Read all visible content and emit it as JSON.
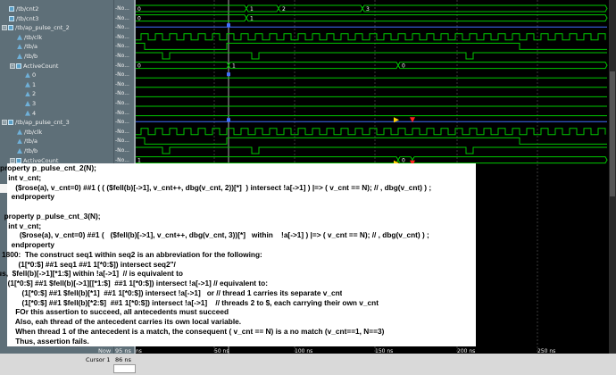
{
  "signals": [
    {
      "label": "/tb/cnt2",
      "type": "bus",
      "indent": 0,
      "toggle": "none",
      "value": "-No..."
    },
    {
      "label": "/tb/cnt3",
      "type": "bus",
      "indent": 0,
      "toggle": "none",
      "value": "-No..."
    },
    {
      "label": "/tb/ap_pulse_cnt_2",
      "type": "bus",
      "indent": 0,
      "toggle": "-",
      "value": "-No..."
    },
    {
      "label": "/tb/clk",
      "type": "bit",
      "indent": 1,
      "toggle": "none",
      "value": "-No..."
    },
    {
      "label": "/tb/a",
      "type": "bit",
      "indent": 1,
      "toggle": "none",
      "value": "-No..."
    },
    {
      "label": "/tb/b",
      "type": "bit",
      "indent": 1,
      "toggle": "none",
      "value": "-No..."
    },
    {
      "label": "ActiveCount",
      "type": "bus",
      "indent": 1,
      "toggle": "-",
      "value": "-No..."
    },
    {
      "label": "0",
      "type": "bit",
      "indent": 2,
      "toggle": "none",
      "value": "-No..."
    },
    {
      "label": "1",
      "type": "bit",
      "indent": 2,
      "toggle": "none",
      "value": "-No..."
    },
    {
      "label": "2",
      "type": "bit",
      "indent": 2,
      "toggle": "none",
      "value": "-No..."
    },
    {
      "label": "3",
      "type": "bit",
      "indent": 2,
      "toggle": "none",
      "value": "-No..."
    },
    {
      "label": "4",
      "type": "bit",
      "indent": 2,
      "toggle": "none",
      "value": "-No..."
    },
    {
      "label": "/tb/ap_pulse_cnt_3",
      "type": "bus",
      "indent": 0,
      "toggle": "-",
      "value": "-No..."
    },
    {
      "label": "/tb/clk",
      "type": "bit",
      "indent": 1,
      "toggle": "none",
      "value": "-No..."
    },
    {
      "label": "/tb/a",
      "type": "bit",
      "indent": 1,
      "toggle": "none",
      "value": "-No..."
    },
    {
      "label": "/tb/b",
      "type": "bit",
      "indent": 1,
      "toggle": "none",
      "value": "-No..."
    },
    {
      "label": "ActiveCount",
      "type": "bus",
      "indent": 1,
      "toggle": "-",
      "value": "-No..."
    },
    {
      "label": "0",
      "type": "bit",
      "indent": 2,
      "toggle": "none",
      "value": "-No..."
    },
    {
      "label": "1",
      "type": "bit",
      "indent": 2,
      "toggle": "none",
      "value": "-No..."
    },
    {
      "label": "2",
      "type": "bit",
      "indent": 2,
      "toggle": "none",
      "value": "-No...",
      "selected": true
    },
    {
      "label": "3",
      "type": "bit",
      "indent": 2,
      "toggle": "none",
      "value": "-No..."
    },
    {
      "label": "4",
      "type": "bit",
      "indent": 2,
      "toggle": "none",
      "value": "-No..."
    }
  ],
  "bus_labels": {
    "cnt2": [
      "0",
      "1",
      "2",
      "3"
    ],
    "cnt3": [
      "0",
      "1"
    ],
    "active2": [
      "0",
      "1",
      "0"
    ],
    "active3": [
      "1",
      "0"
    ]
  },
  "footer": {
    "now_label": "Now",
    "now_value": "95 ns",
    "cursor_label": "Cursor 1",
    "cursor_value": "86 ns",
    "cursor_box": "",
    "ticks": [
      "ns",
      "50 ns",
      "100 ns",
      "150 ns",
      "200 ns",
      "250 ns"
    ]
  },
  "annotation": [
    "property p_pulse_cnt_2(N);",
    "    int v_cnt;",
    "    ($rose(a), v_cnt=0) ##1 ( ( ($fell(b)[->1], v_cnt++, dbg(v_cnt, 2))[*]  ) intersect !a[->1] ) |=> ( v_cnt == N); // , dbg(v_cnt) ) ;",
    "  endproperty",
    "",
    "  property p_pulse_cnt_3(N);",
    "    int v_cnt;",
    "      ($rose(a), v_cnt=0) ##1 (   ($fell(b)[->1], v_cnt++, dbg(v_cnt, 3))[*]   within    !a[->1] ) |=> ( v_cnt == N); // , dbg(v_cnt) ) ;",
    "  endproperty",
    "1800:  The construct seq1 within seq2 is an abbreviation for the following:",
    "        (1[*0:$] ##1 seq1 ##1 1[*0:$]) intersect seq2\"/",
    "// Thus,  $fell(b)[->1][*1:$] within !a[->1]  // is equivalent to",
    "/*          (1[*0:$] ##1 $fell(b)[->1][[*1:$]  ##1 1[*0:$]) intersect !a[->1] // equivalent to:",
    "        (1[*0:$] ##1 $fell(b)[*1]  ##1 1[*0:$]) intersect !a[->1]   or // thread 1 carries its separate v_cnt",
    "        (1[*0:$] ##1 $fell(b)[*2:$]  ##1 1[*0:$]) intersect !a[->1]    // threads 2 to $, each carrying their own v_cnt",
    "    FOr this assertion to succeed, all antecedents must succeed",
    "    Also, eah thread of the antecedent carries its own local variable.",
    "    When thread 1 of the antecedent is a match, the consequent ( v_cnt == N) is a no match (v_cnt==1, N==3)",
    "    Thus, assertion fails."
  ],
  "colors": {
    "signal_green": "#00c800",
    "bus_blue": "#4070ff",
    "marker_yellow": "#ffd000",
    "marker_red": "#ff2020",
    "pane_bg": "#5e6f78"
  }
}
